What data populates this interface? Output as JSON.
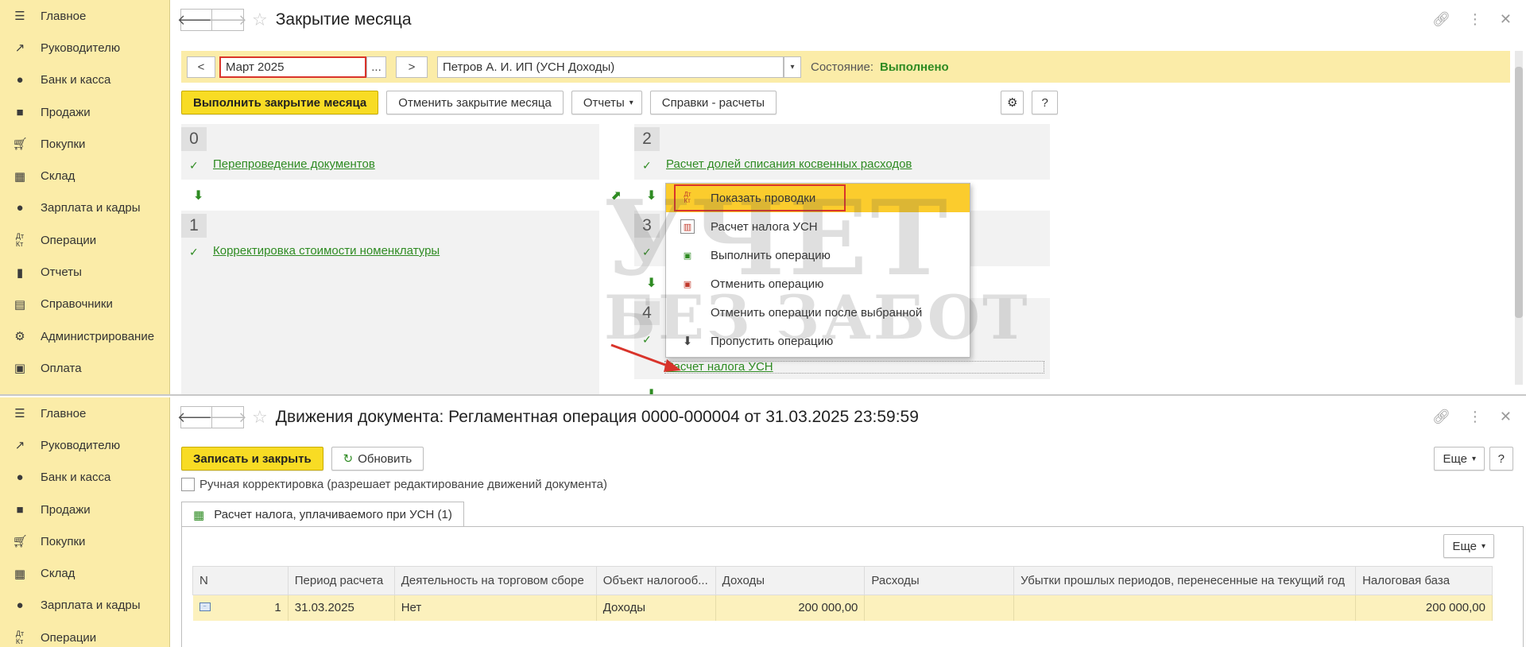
{
  "sidebar": {
    "items": [
      {
        "label": "Главное",
        "icon": "menu-icon"
      },
      {
        "label": "Руководителю",
        "icon": "trend-icon"
      },
      {
        "label": "Банк и касса",
        "icon": "ruble-coin-icon"
      },
      {
        "label": "Продажи",
        "icon": "shopping-bag-icon"
      },
      {
        "label": "Покупки",
        "icon": "cart-icon"
      },
      {
        "label": "Склад",
        "icon": "warehouse-icon"
      },
      {
        "label": "Зарплата и кадры",
        "icon": "person-icon"
      },
      {
        "label": "Операции",
        "icon": "dt-kt-icon"
      },
      {
        "label": "Отчеты",
        "icon": "bar-chart-icon"
      },
      {
        "label": "Справочники",
        "icon": "book-icon"
      },
      {
        "label": "Администрирование",
        "icon": "gear-icon"
      },
      {
        "label": "Оплата",
        "icon": "payment-icon"
      }
    ]
  },
  "top": {
    "title": "Закрытие месяца",
    "period_prev": "<",
    "period_value": "Март 2025",
    "period_ellipsis": "...",
    "period_next": ">",
    "org_value": "Петров А. И. ИП (УСН Доходы)",
    "status_label": "Состояние:",
    "status_value": "Выполнено",
    "btn_execute": "Выполнить закрытие месяца",
    "btn_cancel": "Отменить закрытие месяца",
    "btn_reports": "Отчеты",
    "btn_help_calc": "Справки - расчеты",
    "btn_question": "?",
    "steps": {
      "s0": {
        "num": "0",
        "link": "Перепроведение документов"
      },
      "s1": {
        "num": "1",
        "link": "Корректировка стоимости номенклатуры"
      },
      "s2": {
        "num": "2",
        "link": "Расчет долей списания косвенных расходов"
      },
      "s3": {
        "num": "3"
      },
      "s4": {
        "num": "4",
        "link": "Расчет налога УСН"
      }
    },
    "context_menu": [
      {
        "label": "Показать проводки",
        "icon": "dt-kt-icon"
      },
      {
        "label": "Расчет налога УСН",
        "icon": "report-icon"
      },
      {
        "label": "Выполнить операцию",
        "icon": "execute-doc-icon"
      },
      {
        "label": "Отменить операцию",
        "icon": "cancel-doc-icon"
      },
      {
        "label": "Отменить операции после выбранной",
        "icon": ""
      },
      {
        "label": "Пропустить операцию",
        "icon": "skip-arrow-icon"
      }
    ]
  },
  "bottom": {
    "title": "Движения документа: Регламентная операция 0000-000004 от 31.03.2025 23:59:59",
    "btn_save_close": "Записать и закрыть",
    "btn_refresh": "Обновить",
    "btn_more": "Еще",
    "btn_question": "?",
    "manual_label": "Ручная корректировка (разрешает редактирование движений документа)",
    "tab_label": "Расчет налога, уплачиваемого при УСН (1)",
    "tab_more": "Еще",
    "table": {
      "headers": [
        "N",
        "Период расчета",
        "Деятельность на торговом сборе",
        "Объект налогооб...",
        "Доходы",
        "Расходы",
        "Убытки прошлых периодов, перенесенные на текущий год",
        "Налоговая база"
      ],
      "rows": [
        [
          "1",
          "31.03.2025",
          "Нет",
          "Доходы",
          "200 000,00",
          "",
          "",
          "200 000,00"
        ]
      ]
    }
  },
  "watermark": {
    "line1": "УЧЕТ",
    "line2": "БЕЗ ЗАБОТ"
  },
  "colors": {
    "sidebar_bg": "#fbeca8",
    "accent_yellow": "#f8dc24",
    "link_green": "#2e8b22",
    "highlight_red": "#d9342b"
  }
}
